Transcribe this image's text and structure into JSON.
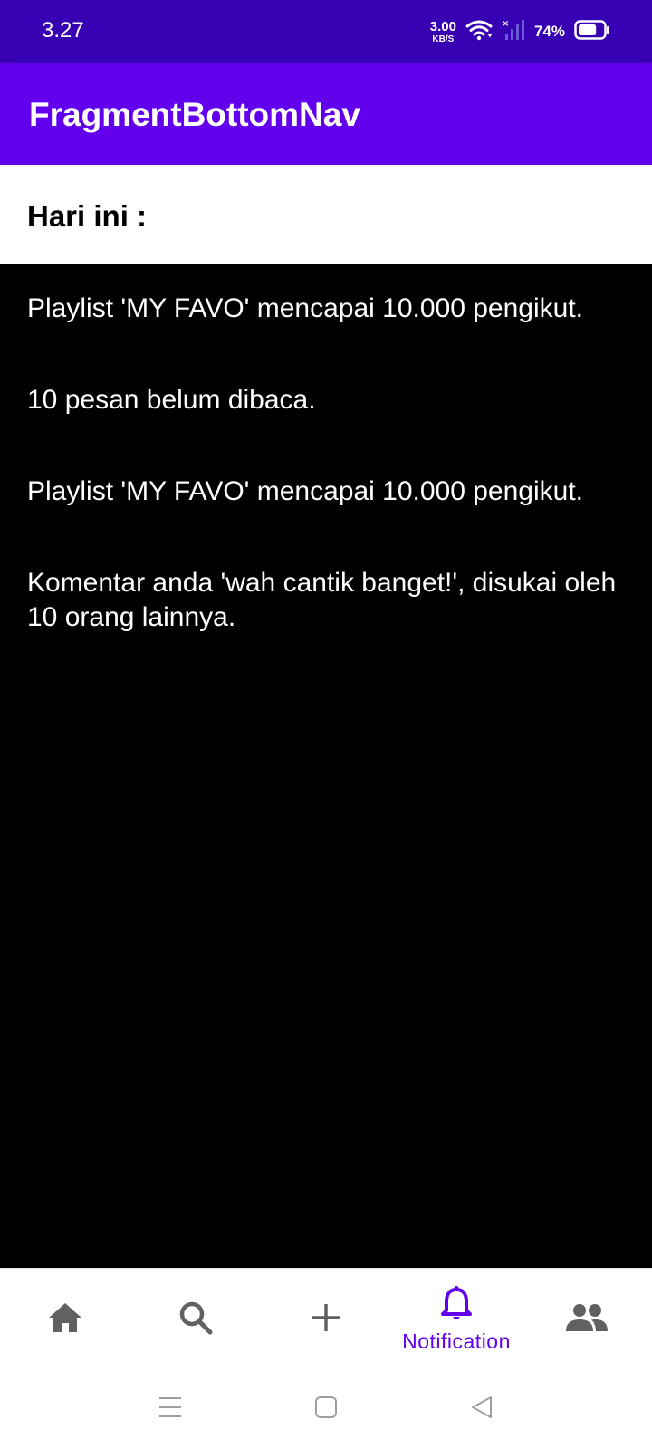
{
  "status_bar": {
    "time": "3.27",
    "net_speed_value": "3.00",
    "net_speed_unit": "KB/S",
    "battery_percent": "74%",
    "battery_level": 0.74
  },
  "app_bar": {
    "title": "FragmentBottomNav"
  },
  "section": {
    "header": "Hari ini :"
  },
  "notifications": [
    "Playlist 'MY FAVO' mencapai 10.000 pengikut.",
    "10 pesan belum dibaca.",
    "Playlist 'MY FAVO' mencapai 10.000 pengikut.",
    "Komentar anda 'wah cantik banget!', disukai oleh 10 orang lainnya."
  ],
  "bottom_nav": {
    "items": [
      {
        "icon": "home-icon",
        "label": "",
        "active": false
      },
      {
        "icon": "search-icon",
        "label": "",
        "active": false
      },
      {
        "icon": "add-icon",
        "label": "",
        "active": false
      },
      {
        "icon": "bell-icon",
        "label": "Notification",
        "active": true
      },
      {
        "icon": "people-icon",
        "label": "",
        "active": false
      }
    ],
    "active_color": "#6200EE",
    "inactive_color": "#616161"
  },
  "colors": {
    "status_bar": "#3700B3",
    "primary": "#6200EE",
    "background": "#000000"
  }
}
